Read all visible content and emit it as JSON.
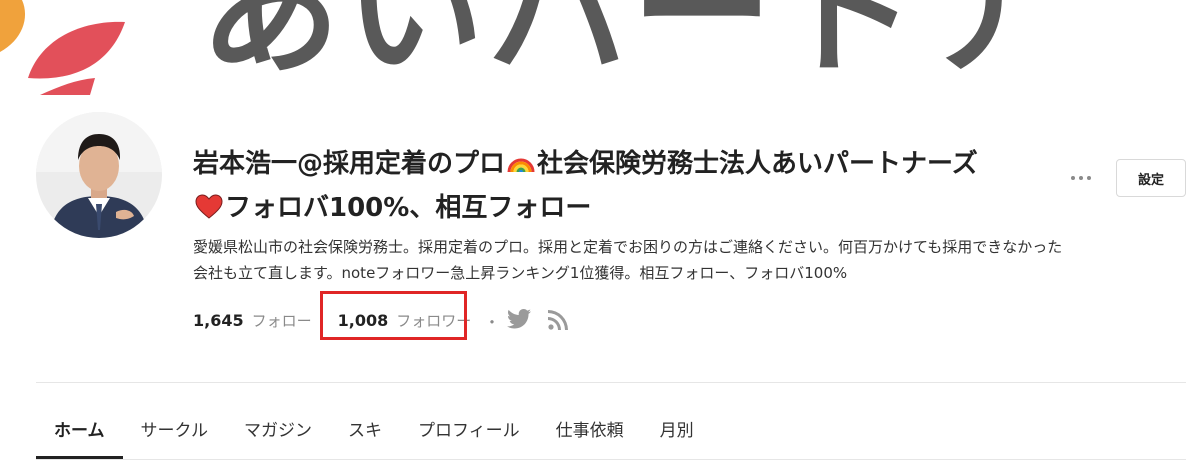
{
  "header": {
    "banner_text": "あいパートナ",
    "brand_colors": {
      "leaf_orange": "#f0a23c",
      "leaf_red": "#e2505a",
      "banner_text": "#595959"
    }
  },
  "profile": {
    "avatar_icon": "profile-photo",
    "name_line1": "岩本浩一@採用定着のプロ",
    "name_line1_emoji": "rainbow-emoji",
    "name_line1_cont": "社会保険労務士法人あいパートナーズ",
    "name_line2_emoji": "red-heart-emoji",
    "name_line2": "フォロバ100%、相互フォロー",
    "bio_line1": "愛媛県松山市の社会保険労務士。採用定着のプロ。採用と定着でお困りの方はご連絡ください。何百万かけても採用できなかった",
    "bio_line2": "会社も立て直します。noteフォロワー急上昇ランキング1位獲得。相互フォロー、フォロバ100%"
  },
  "actions": {
    "more_icon": "more-horizontal-icon",
    "settings_label": "設定"
  },
  "stats": {
    "following_count": "1,645",
    "following_label": "フォロー",
    "followers_count": "1,008",
    "followers_label": "フォロワー",
    "separator": "・",
    "twitter_icon": "twitter-icon",
    "rss_icon": "rss-icon",
    "highlight_color": "#e02626"
  },
  "tabs": [
    {
      "label": "ホーム",
      "active": true
    },
    {
      "label": "サークル",
      "active": false
    },
    {
      "label": "マガジン",
      "active": false
    },
    {
      "label": "スキ",
      "active": false
    },
    {
      "label": "プロフィール",
      "active": false
    },
    {
      "label": "仕事依頼",
      "active": false
    },
    {
      "label": "月別",
      "active": false
    }
  ]
}
